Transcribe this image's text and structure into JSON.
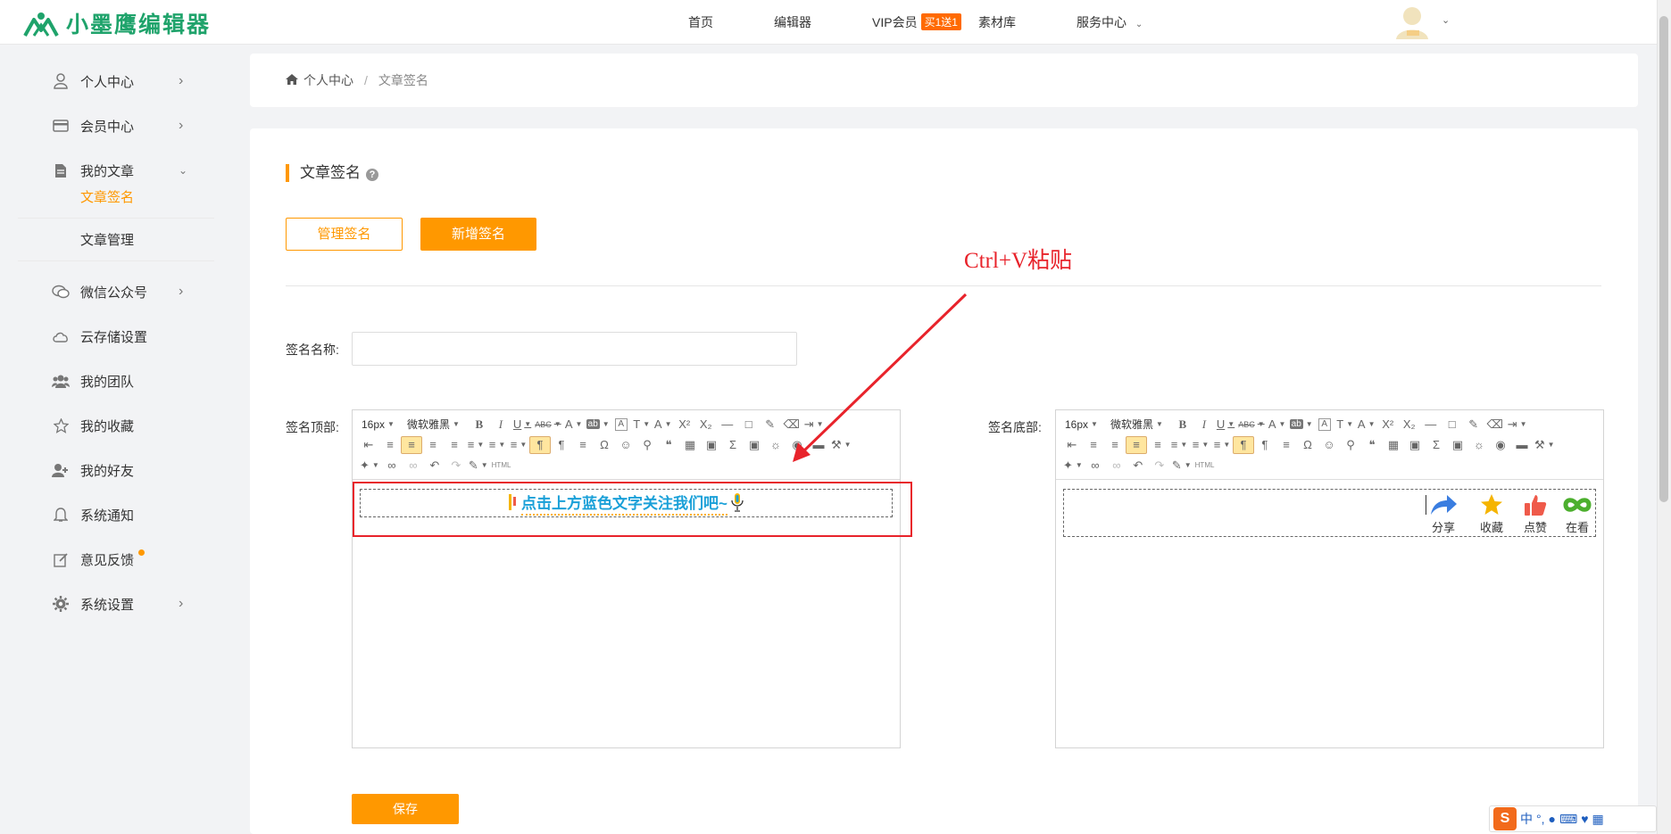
{
  "brand": {
    "name": "小墨鹰编辑器",
    "color": "#1fa36b"
  },
  "nav": {
    "home": "首页",
    "editor": "编辑器",
    "vip": "VIP会员",
    "vip_badge": "买1送1",
    "materials": "素材库",
    "service": "服务中心"
  },
  "sidebar": {
    "items": [
      {
        "label": "个人中心",
        "icon": "user-icon"
      },
      {
        "label": "会员中心",
        "icon": "card-icon"
      },
      {
        "label": "我的文章",
        "icon": "document-icon"
      },
      {
        "label": "文章签名",
        "icon": ""
      },
      {
        "label": "文章管理",
        "icon": ""
      },
      {
        "label": "微信公众号",
        "icon": "wechat-icon"
      },
      {
        "label": "云存储设置",
        "icon": "cloud-icon"
      },
      {
        "label": "我的团队",
        "icon": "team-icon"
      },
      {
        "label": "我的收藏",
        "icon": "star-icon"
      },
      {
        "label": "我的好友",
        "icon": "add-friend-icon"
      },
      {
        "label": "系统通知",
        "icon": "bell-icon"
      },
      {
        "label": "意见反馈",
        "icon": "edit-icon"
      },
      {
        "label": "系统设置",
        "icon": "gear-icon"
      }
    ]
  },
  "breadcrumb": {
    "home": "个人中心",
    "separator": "/",
    "current": "文章签名"
  },
  "main": {
    "title": "文章签名",
    "manage_button": "管理签名",
    "add_button": "新增签名",
    "name_label": "签名名称:",
    "name_value": "",
    "top_label": "签名顶部:",
    "bottom_label": "签名底部:",
    "save_button": "保存",
    "accent_color": "#ff9800"
  },
  "editor": {
    "font_size": "16px",
    "font_family": "微软雅黑",
    "html_label": "HTML"
  },
  "top_editor": {
    "content": "点击上方蓝色文字关注我们吧~"
  },
  "bottom_editor": {
    "actions": [
      {
        "label": "分享",
        "icon": "share-icon",
        "color": "#3a7de0"
      },
      {
        "label": "收藏",
        "icon": "star-icon",
        "color": "#f5b400"
      },
      {
        "label": "点赞",
        "icon": "thumbs-up-icon",
        "color": "#ef5a4a"
      },
      {
        "label": "在看",
        "icon": "infinity-icon",
        "color": "#4caf2e"
      }
    ]
  },
  "annotation": {
    "text": "Ctrl+V粘贴",
    "color": "#e8232b"
  },
  "ime": {
    "logo": "S",
    "lang": "中"
  }
}
